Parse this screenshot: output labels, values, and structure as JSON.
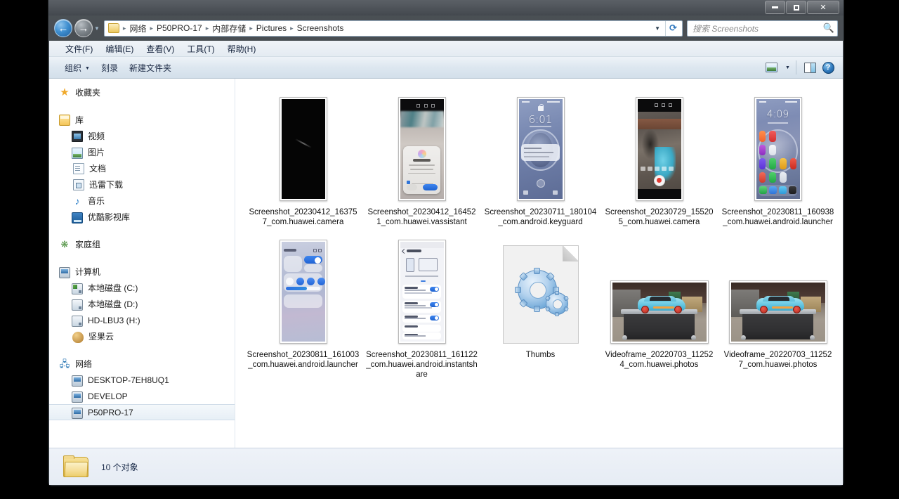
{
  "window": {
    "minimize_label": "最小化",
    "maximize_label": "最大化",
    "close_label": "关闭"
  },
  "nav": {
    "back_label": "后退",
    "forward_label": "前进",
    "recent_label": "最近浏览的位置",
    "refresh_label": "刷新",
    "breadcrumbs": [
      "网络",
      "P50PRO-17",
      "内部存储",
      "Pictures",
      "Screenshots"
    ]
  },
  "search": {
    "placeholder": "搜索 Screenshots",
    "icon": "search-icon"
  },
  "menubar": {
    "items": [
      "文件(F)",
      "编辑(E)",
      "查看(V)",
      "工具(T)",
      "帮助(H)"
    ]
  },
  "commandbar": {
    "organize_label": "组织",
    "burn_label": "刻录",
    "newfolder_label": "新建文件夹",
    "view_icon": "view-icon",
    "preview_pane_icon": "preview-pane-icon",
    "help_icon": "help-icon"
  },
  "sidebar": {
    "groups": [
      {
        "header": {
          "label": "收藏夹",
          "icon": "star-icon",
          "icon_class": "ic-star",
          "glyph": "★"
        },
        "items": []
      },
      {
        "header": {
          "label": "库",
          "icon": "library-icon",
          "icon_class": "ic-lib",
          "glyph": ""
        },
        "items": [
          {
            "label": "视频",
            "icon": "video-icon",
            "icon_class": "ic-video",
            "glyph": ""
          },
          {
            "label": "图片",
            "icon": "pictures-icon",
            "icon_class": "ic-pic",
            "glyph": ""
          },
          {
            "label": "文档",
            "icon": "documents-icon",
            "icon_class": "ic-doc",
            "glyph": ""
          },
          {
            "label": "迅雷下载",
            "icon": "downloads-icon",
            "icon_class": "ic-dl",
            "glyph": ""
          },
          {
            "label": "音乐",
            "icon": "music-icon",
            "icon_class": "ic-music",
            "glyph": "♪"
          },
          {
            "label": "优酷影视库",
            "icon": "youku-library-icon",
            "icon_class": "ic-youku",
            "glyph": ""
          }
        ]
      },
      {
        "header": {
          "label": "家庭组",
          "icon": "homegroup-icon",
          "icon_class": "ic-home",
          "glyph": "❋"
        },
        "items": []
      },
      {
        "header": {
          "label": "计算机",
          "icon": "computer-icon",
          "icon_class": "ic-pc",
          "glyph": ""
        },
        "items": [
          {
            "label": "本地磁盘 (C:)",
            "icon": "system-drive-icon",
            "icon_class": "ic-drive sys",
            "glyph": ""
          },
          {
            "label": "本地磁盘 (D:)",
            "icon": "drive-icon",
            "icon_class": "ic-drive",
            "glyph": ""
          },
          {
            "label": "HD-LBU3 (H:)",
            "icon": "drive-icon",
            "icon_class": "ic-drive",
            "glyph": ""
          },
          {
            "label": "坚果云",
            "icon": "nutstore-icon",
            "icon_class": "ic-nut",
            "glyph": ""
          }
        ]
      },
      {
        "header": {
          "label": "网络",
          "icon": "network-icon",
          "icon_class": "ic-net",
          "glyph": "🖧"
        },
        "items": [
          {
            "label": "DESKTOP-7EH8UQ1",
            "icon": "computer-icon",
            "icon_class": "ic-pc",
            "glyph": "",
            "selected": false
          },
          {
            "label": "DEVELOP",
            "icon": "computer-icon",
            "icon_class": "ic-pc",
            "glyph": "",
            "selected": false
          },
          {
            "label": "P50PRO-17",
            "icon": "computer-icon",
            "icon_class": "ic-pc",
            "glyph": "",
            "selected": true
          }
        ]
      }
    ]
  },
  "files": [
    {
      "name": "Screenshot_20230412_163757_com.huawei.camera",
      "art": "black",
      "shape": "phone"
    },
    {
      "name": "Screenshot_20230412_164521_com.huawei.vassistant",
      "art": "vassist",
      "shape": "phone"
    },
    {
      "name": "Screenshot_20230711_180104_com.android.keyguard",
      "art": "lock",
      "shape": "phone",
      "clock": "6:01"
    },
    {
      "name": "Screenshot_20230729_155205_com.huawei.camera",
      "art": "cam",
      "shape": "phone"
    },
    {
      "name": "Screenshot_20230811_160938_com.huawei.android.launcher",
      "art": "home",
      "shape": "phone",
      "clock": "4:09"
    },
    {
      "name": "Screenshot_20230811_161003_com.huawei.android.launcher",
      "art": "ctrl",
      "shape": "phone"
    },
    {
      "name": "Screenshot_20230811_161122_com.huawei.android.instantshare",
      "art": "share",
      "shape": "phone"
    },
    {
      "name": "Thumbs",
      "art": "thumbs",
      "shape": "phone"
    },
    {
      "name": "Videoframe_20220703_112524_com.huawei.photos",
      "art": "car",
      "shape": "wide"
    },
    {
      "name": "Videoframe_20220703_112527_com.huawei.photos",
      "art": "car",
      "shape": "wide"
    }
  ],
  "statusbar": {
    "item_count_text": "10 个对象",
    "folder_icon": "folder-icon"
  },
  "colors": {
    "accent": "#2f77bd",
    "selection": "#e7eff6",
    "window_chrome": "#43484e"
  }
}
